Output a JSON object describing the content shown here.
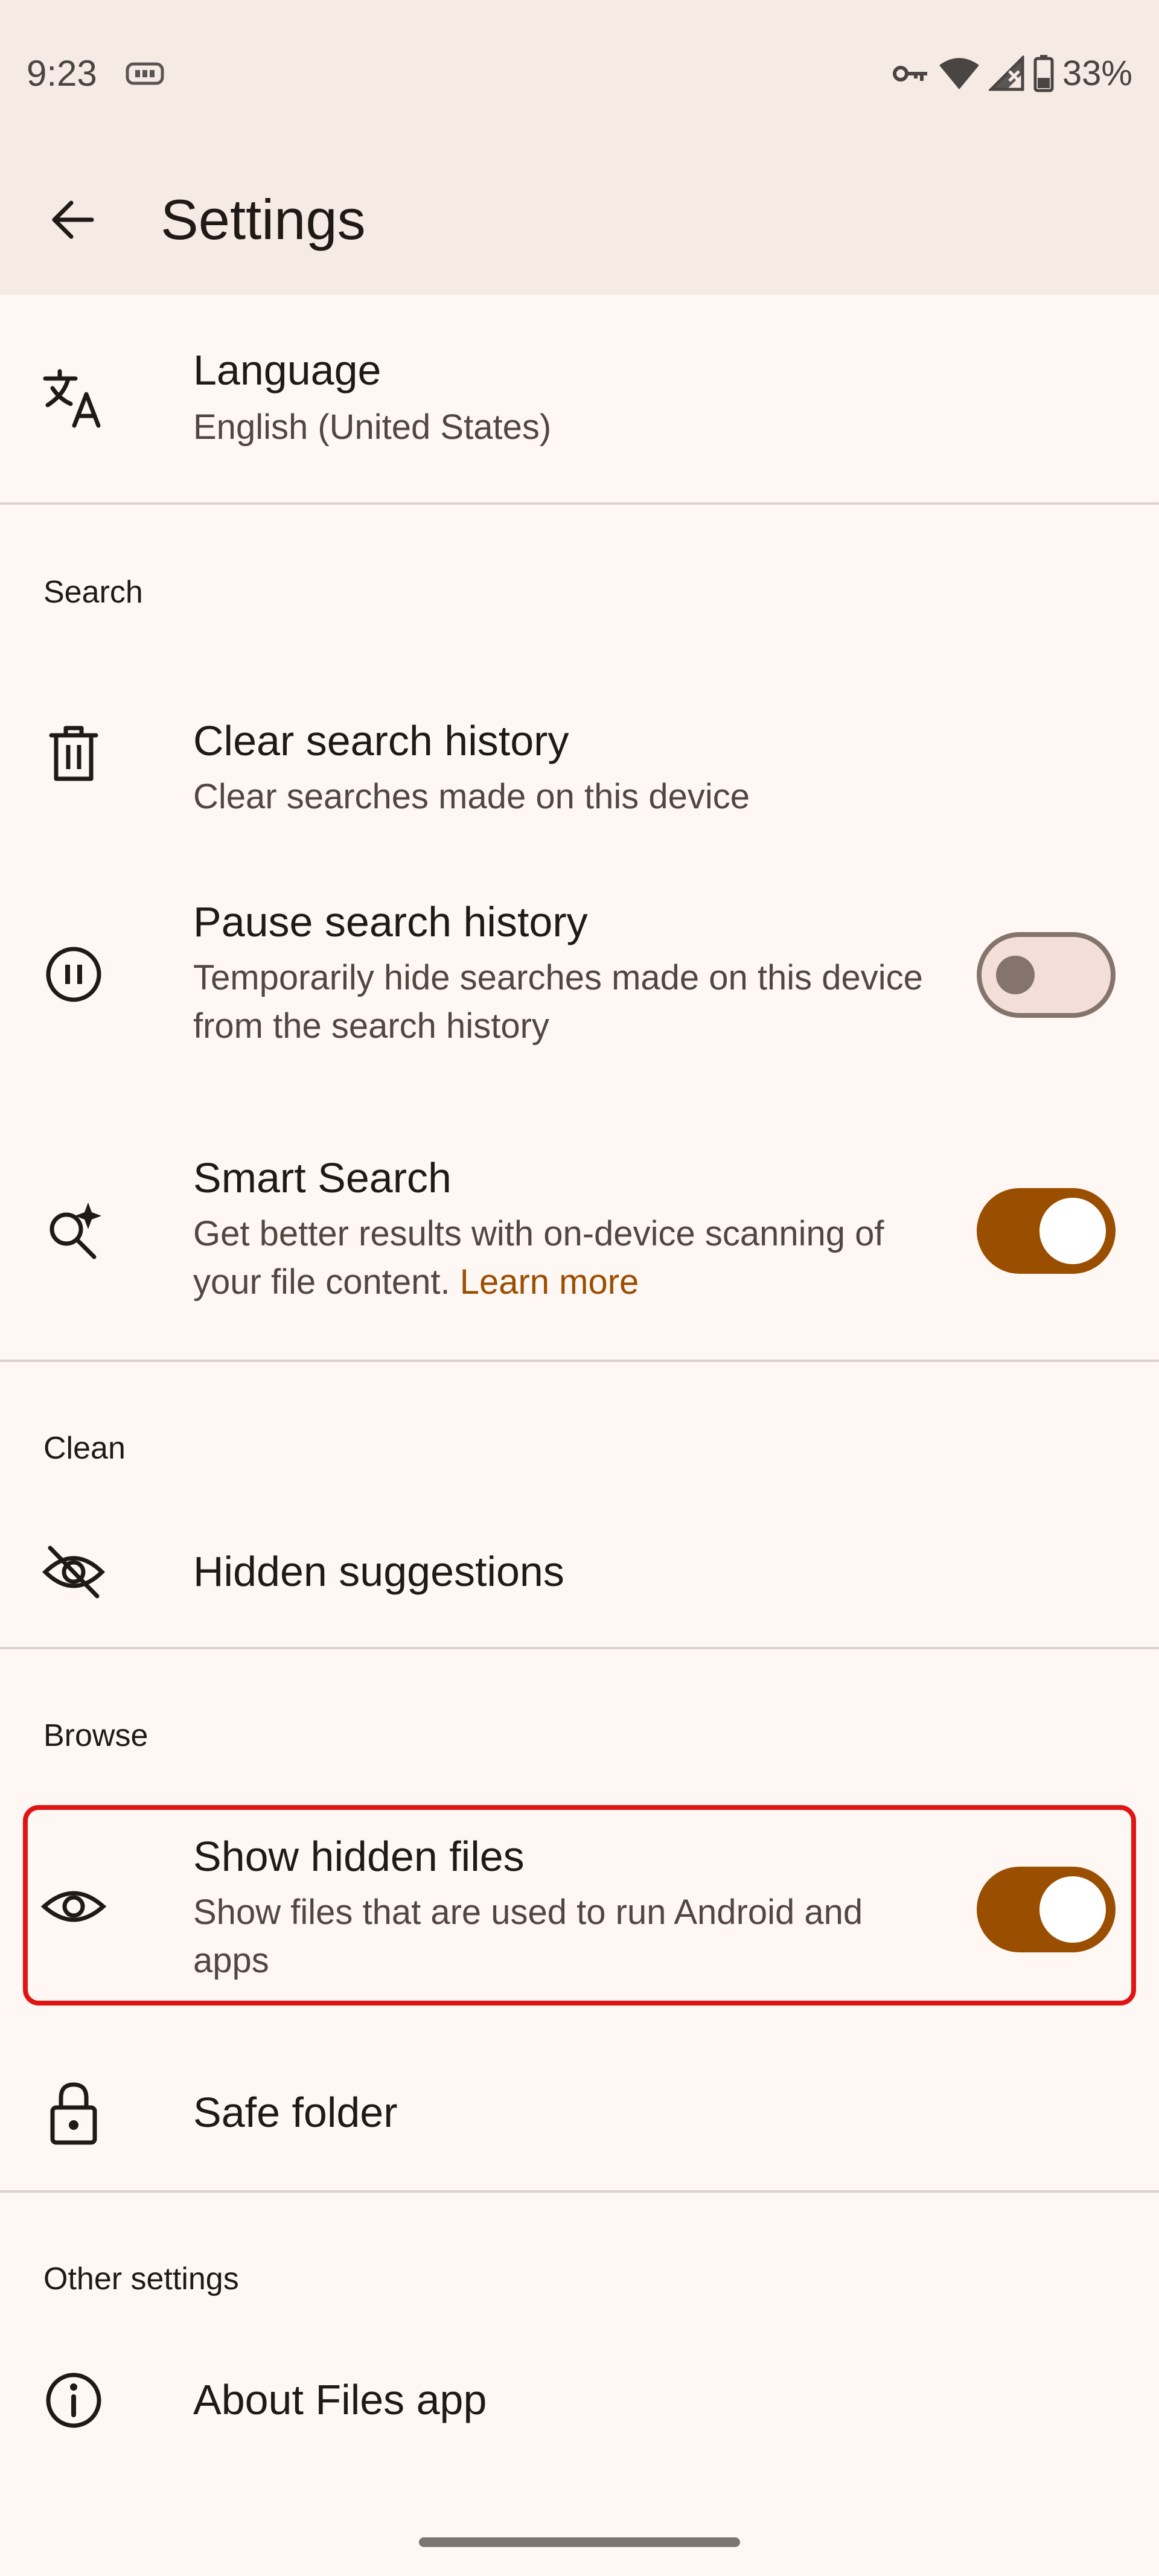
{
  "status_bar": {
    "time": "9:23",
    "battery_text": "33%",
    "icons": [
      "vpn-key-icon",
      "wifi-icon",
      "signal-icon",
      "battery-icon"
    ]
  },
  "app_bar": {
    "title": "Settings"
  },
  "language": {
    "title": "Language",
    "subtitle": "English (United States)"
  },
  "sections": {
    "search": "Search",
    "clean": "Clean",
    "browse": "Browse",
    "other": "Other settings"
  },
  "clear_search_history": {
    "title": "Clear search history",
    "subtitle": "Clear searches made on this device"
  },
  "pause_search_history": {
    "title": "Pause search history",
    "subtitle": "Temporarily hide searches made on this device from the search history",
    "enabled": false
  },
  "smart_search": {
    "title": "Smart Search",
    "subtitle": "Get better results with on-device scanning of your file content.",
    "link": "Learn more",
    "enabled": true
  },
  "hidden_suggestions": {
    "title": "Hidden suggestions"
  },
  "show_hidden_files": {
    "title": "Show hidden files",
    "subtitle": "Show files that are used to run Android and apps",
    "enabled": true
  },
  "safe_folder": {
    "title": "Safe folder"
  },
  "about": {
    "title": "About Files app"
  },
  "colors": {
    "accent": "#9a4e00",
    "background": "#fff7f4",
    "app_bar": "#f6ebe4",
    "highlight": "#e11414"
  }
}
